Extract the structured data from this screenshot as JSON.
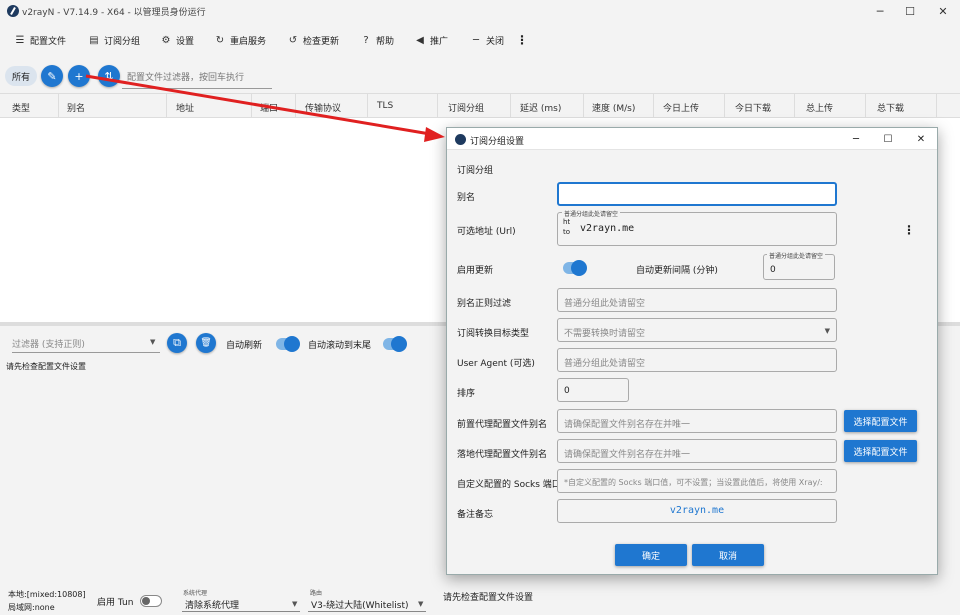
{
  "window": {
    "title": "v2rayN - V7.14.9 - X64 - 以管理员身份运行",
    "min_glyph": "─",
    "max_glyph": "☐",
    "close_glyph": "✕"
  },
  "toolbar": {
    "items": [
      {
        "icon": "☰",
        "label": "配置文件"
      },
      {
        "icon": "▤",
        "label": "订阅分组"
      },
      {
        "icon": "⚙",
        "label": "设置"
      },
      {
        "icon": "↻",
        "label": "重启服务"
      },
      {
        "icon": "↺",
        "label": "检查更新"
      },
      {
        "icon": "?",
        "label": "帮助"
      },
      {
        "icon": "◀",
        "label": "推广"
      },
      {
        "icon": "─",
        "label": "关闭"
      }
    ],
    "more": "⋮"
  },
  "subscription_bar": {
    "all_label": "所有",
    "edit_icon": "✎",
    "add_icon": "+",
    "sort_icon": "⇅",
    "filter_placeholder": "配置文件过滤器，按回车执行"
  },
  "table": {
    "columns": [
      "类型",
      "别名",
      "地址",
      "端口",
      "传输协议",
      "TLS",
      "订阅分组",
      "延迟 (ms)",
      "速度 (M/s)",
      "今日上传",
      "今日下载",
      "总上传",
      "总下载"
    ]
  },
  "log_panel": {
    "filter_placeholder": "过滤器 (支持正则)",
    "copy_icon": "⧉",
    "delete_icon": "🗑",
    "auto_refresh_label": "自动刷新",
    "auto_scroll_label": "自动滚动到末尾",
    "message": "请先检查配置文件设置",
    "auto_refresh_on": true,
    "auto_scroll_on": true
  },
  "status_bar": {
    "local_label": "本地:[mixed:10808]",
    "lan_label": "局域网:none",
    "tun_label": "启用 Tun",
    "tun_on": false,
    "proxy_caption": "系统代理",
    "proxy_value": "清除系统代理",
    "routing_caption": "路由",
    "routing_value": "V3-绕过大陆(Whitelist)",
    "message": "请先检查配置文件设置"
  },
  "dialog": {
    "title": "订阅分组设置",
    "section_title": "订阅分组",
    "fields": {
      "remarks_label": "别名",
      "url_label": "可选地址 (Url)",
      "url_float": "普通分组此处请留空",
      "url_prefix": "ht\nto",
      "url_value": "v2rayn.me",
      "enable_label": "启用更新",
      "enable_on": true,
      "interval_label": "自动更新间隔 (分钟)",
      "interval_float": "普通分组此处请留空",
      "interval_value": "0",
      "filter_label": "别名正则过滤",
      "filter_placeholder": "普通分组此处请留空",
      "convert_label": "订阅转换目标类型",
      "convert_placeholder": "不需要转换时请留空",
      "useragent_label": "User Agent (可选)",
      "useragent_placeholder": "普通分组此处请留空",
      "sort_label": "排序",
      "sort_value": "0",
      "prev_label": "前置代理配置文件别名",
      "prev_placeholder": "请确保配置文件别名存在并唯一",
      "next_label": "落地代理配置文件别名",
      "next_placeholder": "请确保配置文件别名存在并唯一",
      "select_profile": "选择配置文件",
      "socks_label": "自定义配置的 Socks 端口",
      "socks_placeholder": "*自定义配置的 Socks 端口值，可不设置；当设置此值后，将使用 Xray/:",
      "memo_label": "备注备忘",
      "memo_value": "v2rayn.me"
    },
    "ok_label": "确定",
    "cancel_label": "取消",
    "more_icon": "⋮"
  },
  "colors": {
    "accent": "#1f77d0",
    "arrow": "#e02020"
  }
}
